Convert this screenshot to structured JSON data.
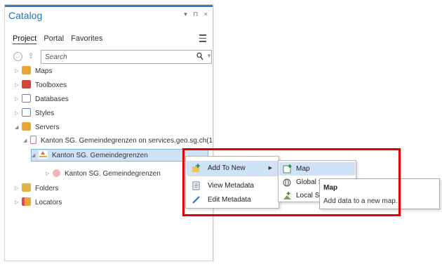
{
  "pane": {
    "title": "Catalog",
    "controls": "▾ ⊓ ×"
  },
  "tabs": [
    {
      "label": "Project",
      "active": true
    },
    {
      "label": "Portal",
      "active": false
    },
    {
      "label": "Favorites",
      "active": false
    }
  ],
  "search": {
    "placeholder": "Search",
    "value": ""
  },
  "tree": [
    {
      "label": "Maps",
      "icon": "maps-icon",
      "expanded": false
    },
    {
      "label": "Toolboxes",
      "icon": "toolbox-icon",
      "expanded": false
    },
    {
      "label": "Databases",
      "icon": "database-icon",
      "expanded": false
    },
    {
      "label": "Styles",
      "icon": "styles-icon",
      "expanded": false
    },
    {
      "label": "Servers",
      "icon": "servers-icon",
      "expanded": true
    },
    {
      "label": "Kanton SG. Gemeindegrenzen on services.geo.sg.ch(1",
      "icon": "service-connection-icon",
      "expanded": true
    },
    {
      "label": "Kanton SG. Gemeindegrenzen",
      "icon": "map-service-icon",
      "expanded": true,
      "selected": true
    },
    {
      "label": "Kanton SG. Gemeindegrenzen",
      "icon": "sublayer-icon",
      "expanded": false
    },
    {
      "label": "Folders",
      "icon": "folder-icon",
      "expanded": false
    },
    {
      "label": "Locators",
      "icon": "locators-icon",
      "expanded": false
    }
  ],
  "context_menu": {
    "items": [
      {
        "label": "Add To New",
        "icon": "add-to-new-icon",
        "has_submenu": true
      },
      {
        "label": "View Metadata",
        "icon": "view-metadata-icon"
      },
      {
        "label": "Edit Metadata",
        "icon": "edit-metadata-icon"
      }
    ]
  },
  "submenu": {
    "items": [
      {
        "label": "Map",
        "icon": "map-icon"
      },
      {
        "label": "Global S",
        "icon": "global-scene-icon"
      },
      {
        "label": "Local S",
        "icon": "local-scene-icon"
      }
    ]
  },
  "tooltip": {
    "title": "Map",
    "body": "Add data to a new map."
  },
  "colors": {
    "accent": "#2f7dcf",
    "selection": "#cfe2f7",
    "highlight_box": "#e00000"
  }
}
